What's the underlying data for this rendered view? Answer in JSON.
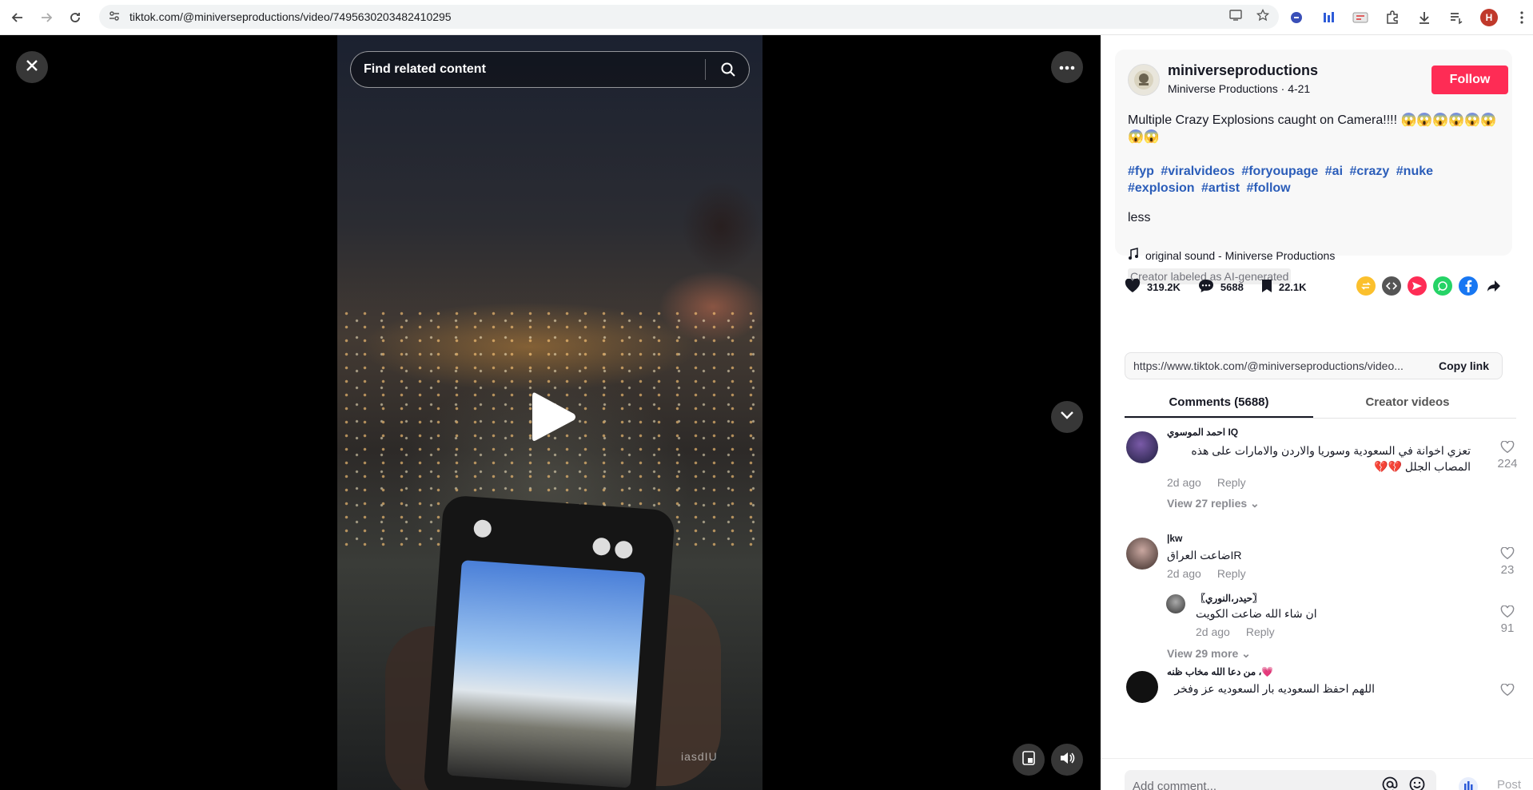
{
  "browser": {
    "url": "tiktok.com/@miniverseproductions/video/7495630203482410295",
    "profile_initial": "H"
  },
  "video": {
    "search_placeholder": "Find related content",
    "watermark": "iasdIU"
  },
  "post": {
    "username": "miniverseproductions",
    "display_name": "Miniverse Productions",
    "date": "4-21",
    "follow_label": "Follow",
    "description": "Multiple Crazy Explosions caught on Camera!!!! 😱😱😱😱😱😱😱😱",
    "hashtags": [
      "#fyp",
      "#viralvideos",
      "#foryoupage",
      "#ai",
      "#crazy",
      "#nuke",
      "#explosion",
      "#artist",
      "#follow"
    ],
    "less_label": "less",
    "sound": "original sound - Miniverse Productions",
    "ai_label": "Creator labeled as AI-generated",
    "likes": "319.2K",
    "comments": "5688",
    "saves": "22.1K",
    "link": "https://www.tiktok.com/@miniverseproductions/video...",
    "copy_link_label": "Copy link"
  },
  "tabs": [
    "Comments (5688)",
    "Creator videos"
  ],
  "comments": [
    {
      "name": "احمد الموسوي IQ",
      "text": "تعزي اخوانة في السعودية وسوريا والاردن والامارات على هذه المصاب الجلل 💔💔",
      "time": "2d ago",
      "reply": "Reply",
      "likes": "224",
      "view_replies": "View 27 replies"
    },
    {
      "name": "|kw",
      "text": "ضاعت العراقIR",
      "time": "2d ago",
      "reply": "Reply",
      "likes": "23"
    },
    {
      "name": "〖حيدر،النوري〗",
      "text": "ان شاء الله ضاعت الكويت",
      "time": "2d ago",
      "reply": "Reply",
      "likes": "91",
      "view_more": "View 29 more"
    },
    {
      "name": "من دعا الله مخاب ظنه ،💗",
      "text": "اللهم احفظ السعوديه بار السعوديه عز وفخر"
    }
  ],
  "composer": {
    "placeholder": "Add comment...",
    "post_label": "Post"
  }
}
